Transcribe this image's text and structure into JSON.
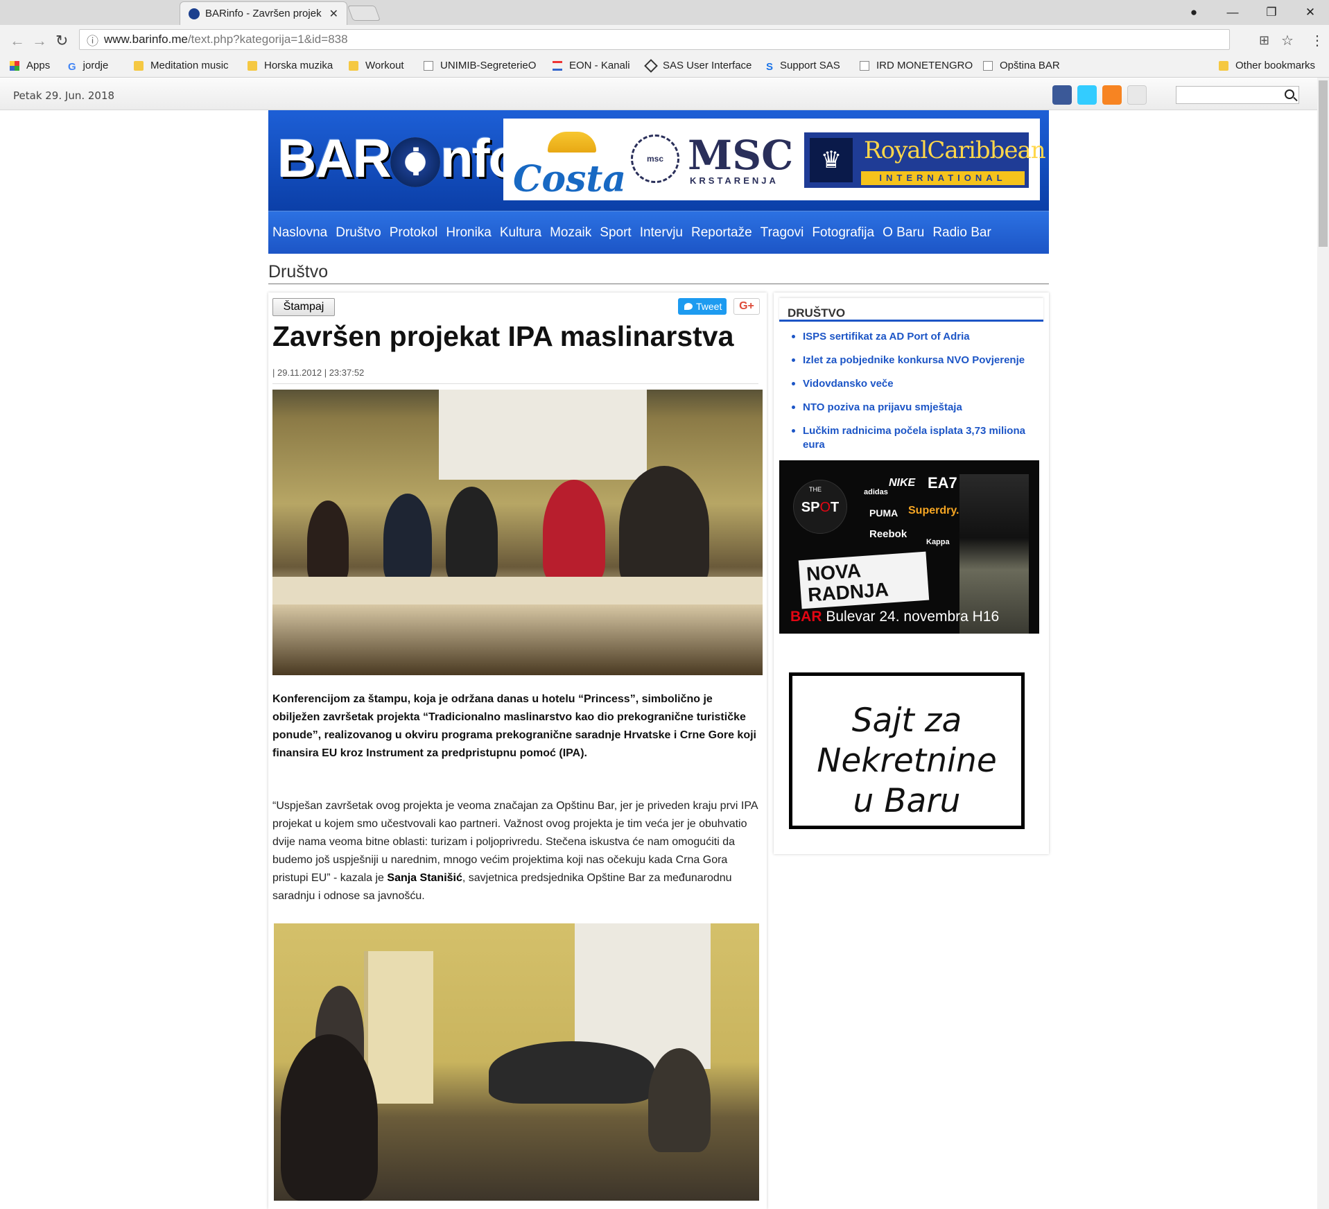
{
  "browser": {
    "tab_title": "BARinfo - Završen projek",
    "url_host": "www.barinfo.me",
    "url_path": "/text.php?kategorija=1&id=838",
    "bookmarks": [
      "Apps",
      "jordje",
      "Meditation music",
      "Horska muzika",
      "Workout",
      "UNIMIB-SegreterieO",
      "EON - Kanali",
      "SAS User Interface",
      "Support SAS",
      "IRD MONETENGRO",
      "Opština BAR"
    ],
    "other_bookmarks": "Other bookmarks"
  },
  "topbar": {
    "date": "Petak 29. Jun. 2018"
  },
  "header": {
    "logo_left": "BAR",
    "logo_right": "nfo",
    "logo_i": "i",
    "ad": {
      "costa": "Costa",
      "msc": "MSC",
      "msc_sub": "KRSTARENJA",
      "msc_badge": "msc",
      "rc_name": "RoyalCaribbean",
      "rc_sub": "INTERNATIONAL"
    }
  },
  "menu": [
    "Naslovna",
    "Društvo",
    "Protokol",
    "Hronika",
    "Kultura",
    "Mozaik",
    "Sport",
    "Intervju",
    "Reportaže",
    "Tragovi",
    "Fotografija",
    "O Baru",
    "Radio Bar"
  ],
  "section": "Društvo",
  "article": {
    "print": "Štampaj",
    "tweet": "Tweet",
    "gplus": "G+",
    "title": "Završen projekat IPA maslinarstva",
    "meta": "| 29.11.2012 | 23:37:52",
    "lead": "Konferencijom za štampu, koja je održana danas u hotelu “Princess”, simbolično je obilježen završetak projekta “Tradicionalno maslinarstvo kao dio prekogranične turističke ponude”, realizovanog u okviru programa prekogranične saradnje Hrvatske i Crne Gore koji finansira EU kroz Instrument za predpristupnu pomoć (IPA).",
    "body_1": "“Uspješan završetak ovog projekta je veoma značajan za Opštinu Bar, jer je priveden kraju prvi IPA projekat u kojem smo učestvovali kao partneri. Važnost ovog projekta je tim veća jer je obuhvatio dvije nama veoma bitne oblasti: turizam i poljoprivredu. Stečena iskustva će nam omogućiti da budemo još uspješniji u narednim, mnogo većim projektima koji nas očekuju kada Crna Gora pristupi EU” - kazala je ",
    "body_name": "Sanja Stanišić",
    "body_2": ", savjetnica predsjednika Opštine Bar za međunarodnu saradnju i odnose sa javnošću."
  },
  "sidebar": {
    "title": "DRUŠTVO",
    "news": [
      "ISPS sertifikat za AD Port of Adria",
      "Izlet za pobjednike konkursa NVO Povjerenje",
      "Vidovdansko veče",
      "NTO poziva na prijavu smještaja",
      "Lučkim radnicima počela isplata 3,73 miliona eura"
    ],
    "spot_ad": {
      "logo_the": "THE",
      "logo_main": "SP",
      "logo_o": "O",
      "logo_t": "T",
      "brands": [
        "adidas",
        "NIKE",
        "EA7",
        "PUMA",
        "Superdry.",
        "Reebok",
        "Kappa"
      ],
      "nova": "NOVA RADNJA",
      "bar": "BAR",
      "address": "Bulevar 24. novembra H16"
    },
    "nekretnine": [
      "Sajt za",
      "Nekretnine",
      "u Baru"
    ]
  }
}
